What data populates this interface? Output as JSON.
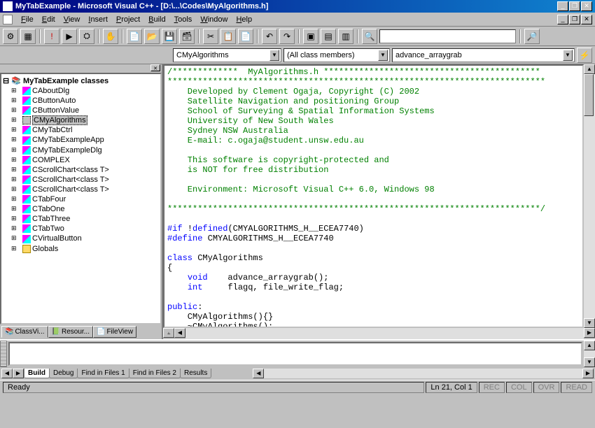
{
  "titlebar": {
    "text": "MyTabExample - Microsoft Visual C++ - [D:\\...\\Codes\\MyAlgorithms.h]"
  },
  "menu": {
    "items": [
      "File",
      "Edit",
      "View",
      "Insert",
      "Project",
      "Build",
      "Tools",
      "Window",
      "Help"
    ]
  },
  "combos": {
    "class_combo": "CMyAlgorithms",
    "member_combo": "(All class members)",
    "func_combo": "advance_arraygrab"
  },
  "tree": {
    "root": "MyTabExample classes",
    "items": [
      {
        "label": "CAboutDlg"
      },
      {
        "label": "CButtonAuto"
      },
      {
        "label": "CButtonValue"
      },
      {
        "label": "CMyAlgorithms",
        "selected": true
      },
      {
        "label": "CMyTabCtrl"
      },
      {
        "label": "CMyTabExampleApp"
      },
      {
        "label": "CMyTabExampleDlg"
      },
      {
        "label": "COMPLEX"
      },
      {
        "label": "CScrollChart<class T>"
      },
      {
        "label": "CScrollChart<class T>"
      },
      {
        "label": "CScrollChart<class T>"
      },
      {
        "label": "CTabFour"
      },
      {
        "label": "CTabOne"
      },
      {
        "label": "CTabThree"
      },
      {
        "label": "CTabTwo"
      },
      {
        "label": "CVirtualButton"
      },
      {
        "label": "Globals",
        "folder": true
      }
    ]
  },
  "sidebar_tabs": [
    {
      "label": "ClassVi..."
    },
    {
      "label": "Resour..."
    },
    {
      "label": "FileView"
    }
  ],
  "code": {
    "lines": [
      {
        "cls": "c-green",
        "text": "/*************  MyAlgorithms.h *******************************************"
      },
      {
        "cls": "c-green",
        "text": "***************************************************************************"
      },
      {
        "cls": "c-green",
        "text": "    Developed by Clement Ogaja, Copyright (C) 2002"
      },
      {
        "cls": "c-green",
        "text": "    Satellite Navigation and positioning Group"
      },
      {
        "cls": "c-green",
        "text": "    School of Surveying & Spatial Information Systems"
      },
      {
        "cls": "c-green",
        "text": "    University of New South Wales"
      },
      {
        "cls": "c-green",
        "text": "    Sydney NSW Australia"
      },
      {
        "cls": "c-green",
        "text": "    E-mail: c.ogaja@student.unsw.edu.au"
      },
      {
        "cls": "c-green",
        "text": ""
      },
      {
        "cls": "c-green",
        "text": "    This software is copyright-protected and"
      },
      {
        "cls": "c-green",
        "text": "    is NOT for free distribution"
      },
      {
        "cls": "c-green",
        "text": ""
      },
      {
        "cls": "c-green",
        "text": "    Environment: Microsoft Visual C++ 6.0, Windows 98"
      },
      {
        "cls": "c-green",
        "text": ""
      },
      {
        "cls": "c-green",
        "text": "**************************************************************************/"
      },
      {
        "cls": "c-black",
        "text": ""
      },
      {
        "cls": "mix1",
        "text": "#if !defined(CMYALGORITHMS_H__ECEA7740)"
      },
      {
        "cls": "mix2",
        "text": "#define CMYALGORITHMS_H__ECEA7740"
      },
      {
        "cls": "c-black",
        "text": ""
      },
      {
        "cls": "mix3",
        "text": "class CMyAlgorithms"
      },
      {
        "cls": "c-black",
        "text": "{"
      },
      {
        "cls": "mix4",
        "text": "    void    advance_arraygrab();"
      },
      {
        "cls": "mix5",
        "text": "    int     flagq, file_write_flag;"
      },
      {
        "cls": "c-black",
        "text": ""
      },
      {
        "cls": "mix6",
        "text": "public:"
      },
      {
        "cls": "c-black",
        "text": "    CMyAlgorithms(){}"
      },
      {
        "cls": "c-black",
        "text": "    ~CMyAlgorithms();"
      }
    ]
  },
  "output_tabs": [
    "Build",
    "Debug",
    "Find in Files 1",
    "Find in Files 2",
    "Results"
  ],
  "status": {
    "ready": "Ready",
    "pos": "Ln 21, Col 1",
    "cells": [
      "REC",
      "COL",
      "OVR",
      "READ"
    ]
  }
}
